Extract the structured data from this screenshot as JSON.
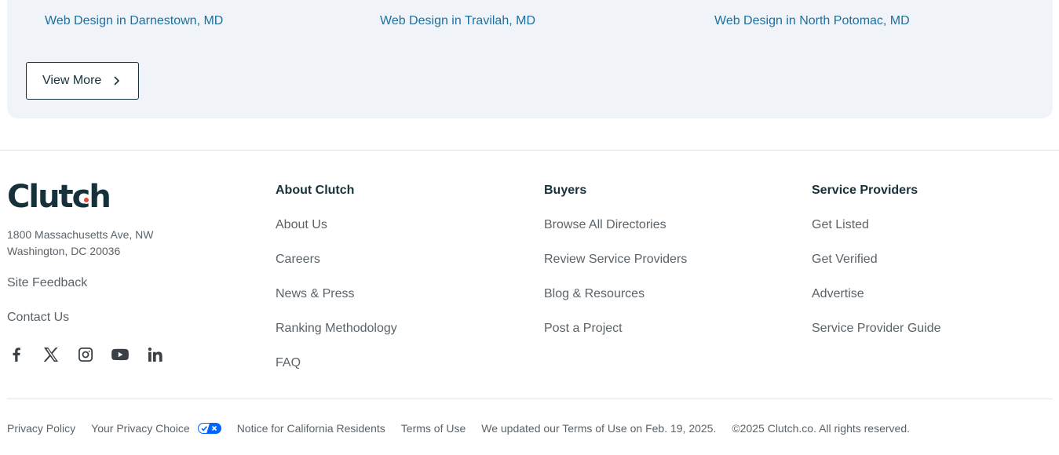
{
  "related": {
    "links": [
      {
        "label": "Web Design in Darnestown, MD"
      },
      {
        "label": "Web Design in Travilah, MD"
      },
      {
        "label": "Web Design in North Potomac, MD"
      }
    ],
    "view_more_label": "View More"
  },
  "footer": {
    "logo_text": "Clutch",
    "address_line1": "1800 Massachusetts Ave, NW",
    "address_line2": "Washington, DC 20036",
    "site_feedback": "Site Feedback",
    "contact_us": "Contact Us",
    "social_icons": [
      "facebook-icon",
      "x-icon",
      "instagram-icon",
      "youtube-icon",
      "linkedin-icon"
    ],
    "columns": [
      {
        "heading": "About Clutch",
        "links": [
          "About Us",
          "Careers",
          "News & Press",
          "Ranking Methodology",
          "FAQ"
        ]
      },
      {
        "heading": "Buyers",
        "links": [
          "Browse All Directories",
          "Review Service Providers",
          "Blog & Resources",
          "Post a Project"
        ]
      },
      {
        "heading": "Service Providers",
        "links": [
          "Get Listed",
          "Get Verified",
          "Advertise",
          "Service Provider Guide"
        ]
      }
    ],
    "legal": {
      "privacy_policy": "Privacy Policy",
      "privacy_choice": "Your Privacy Choice",
      "california_notice": "Notice for California Residents",
      "terms_of_use": "Terms of Use",
      "terms_update": "We updated our Terms of Use on Feb. 19, 2025.",
      "copyright": "©2025 Clutch.co. All rights reserved."
    }
  },
  "colors": {
    "link_blue": "#1f6f9e",
    "heading_dark": "#17313b",
    "text_gray": "#5b6369",
    "panel_bg": "#f0f4f8",
    "logo_red": "#ef4335",
    "privacy_toggle_blue": "#0066ff"
  }
}
